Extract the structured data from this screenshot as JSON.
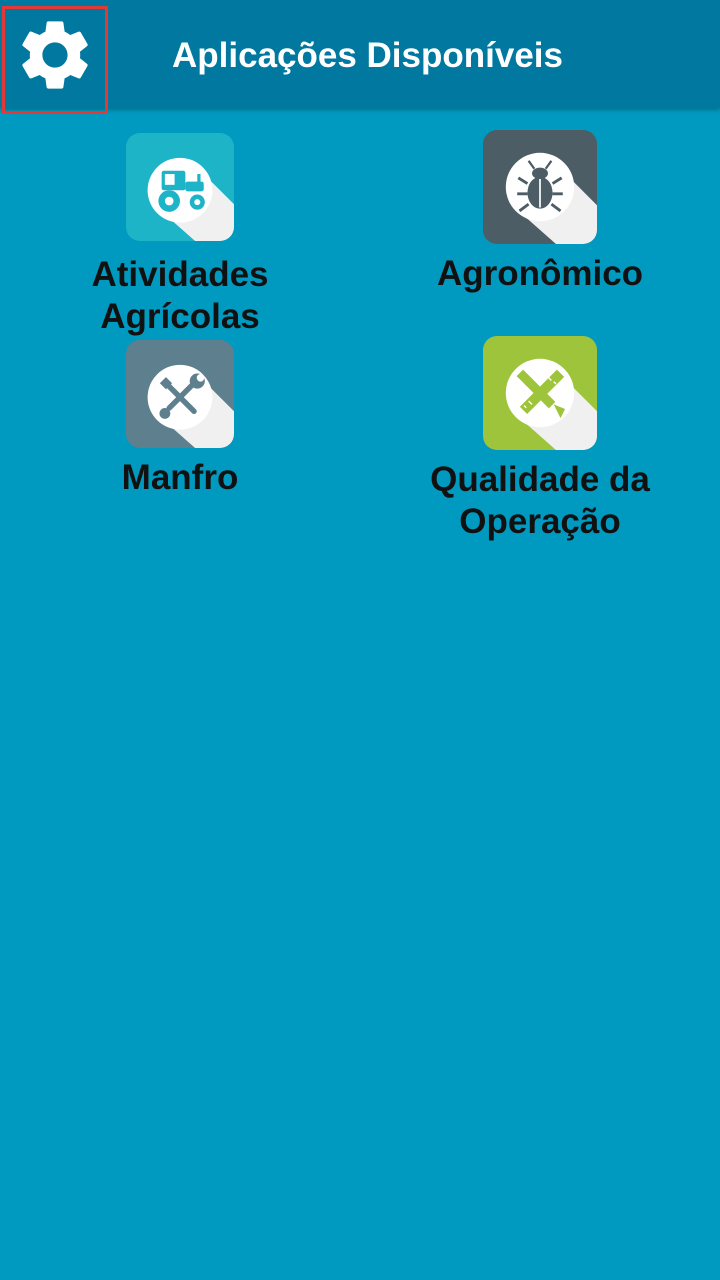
{
  "header": {
    "title": "Aplicações Disponíveis",
    "settings_icon": "gear-icon"
  },
  "apps": [
    {
      "line1": "Atividades",
      "line2": "Agrícolas",
      "icon": "tractor-icon",
      "color": "#1eb4c8"
    },
    {
      "line1": "Agronômico",
      "line2": "",
      "icon": "bug-icon",
      "color": "#4d5d66"
    },
    {
      "line1": "Manfro",
      "line2": "",
      "icon": "tools-icon",
      "color": "#5e7f8e"
    },
    {
      "line1": "Qualidade da",
      "line2": "Operação",
      "icon": "ruler-pencil-icon",
      "color": "#9ec43b"
    }
  ],
  "colors": {
    "background": "#0099bf",
    "appbar": "#0078a0",
    "highlight": "#e53935"
  }
}
